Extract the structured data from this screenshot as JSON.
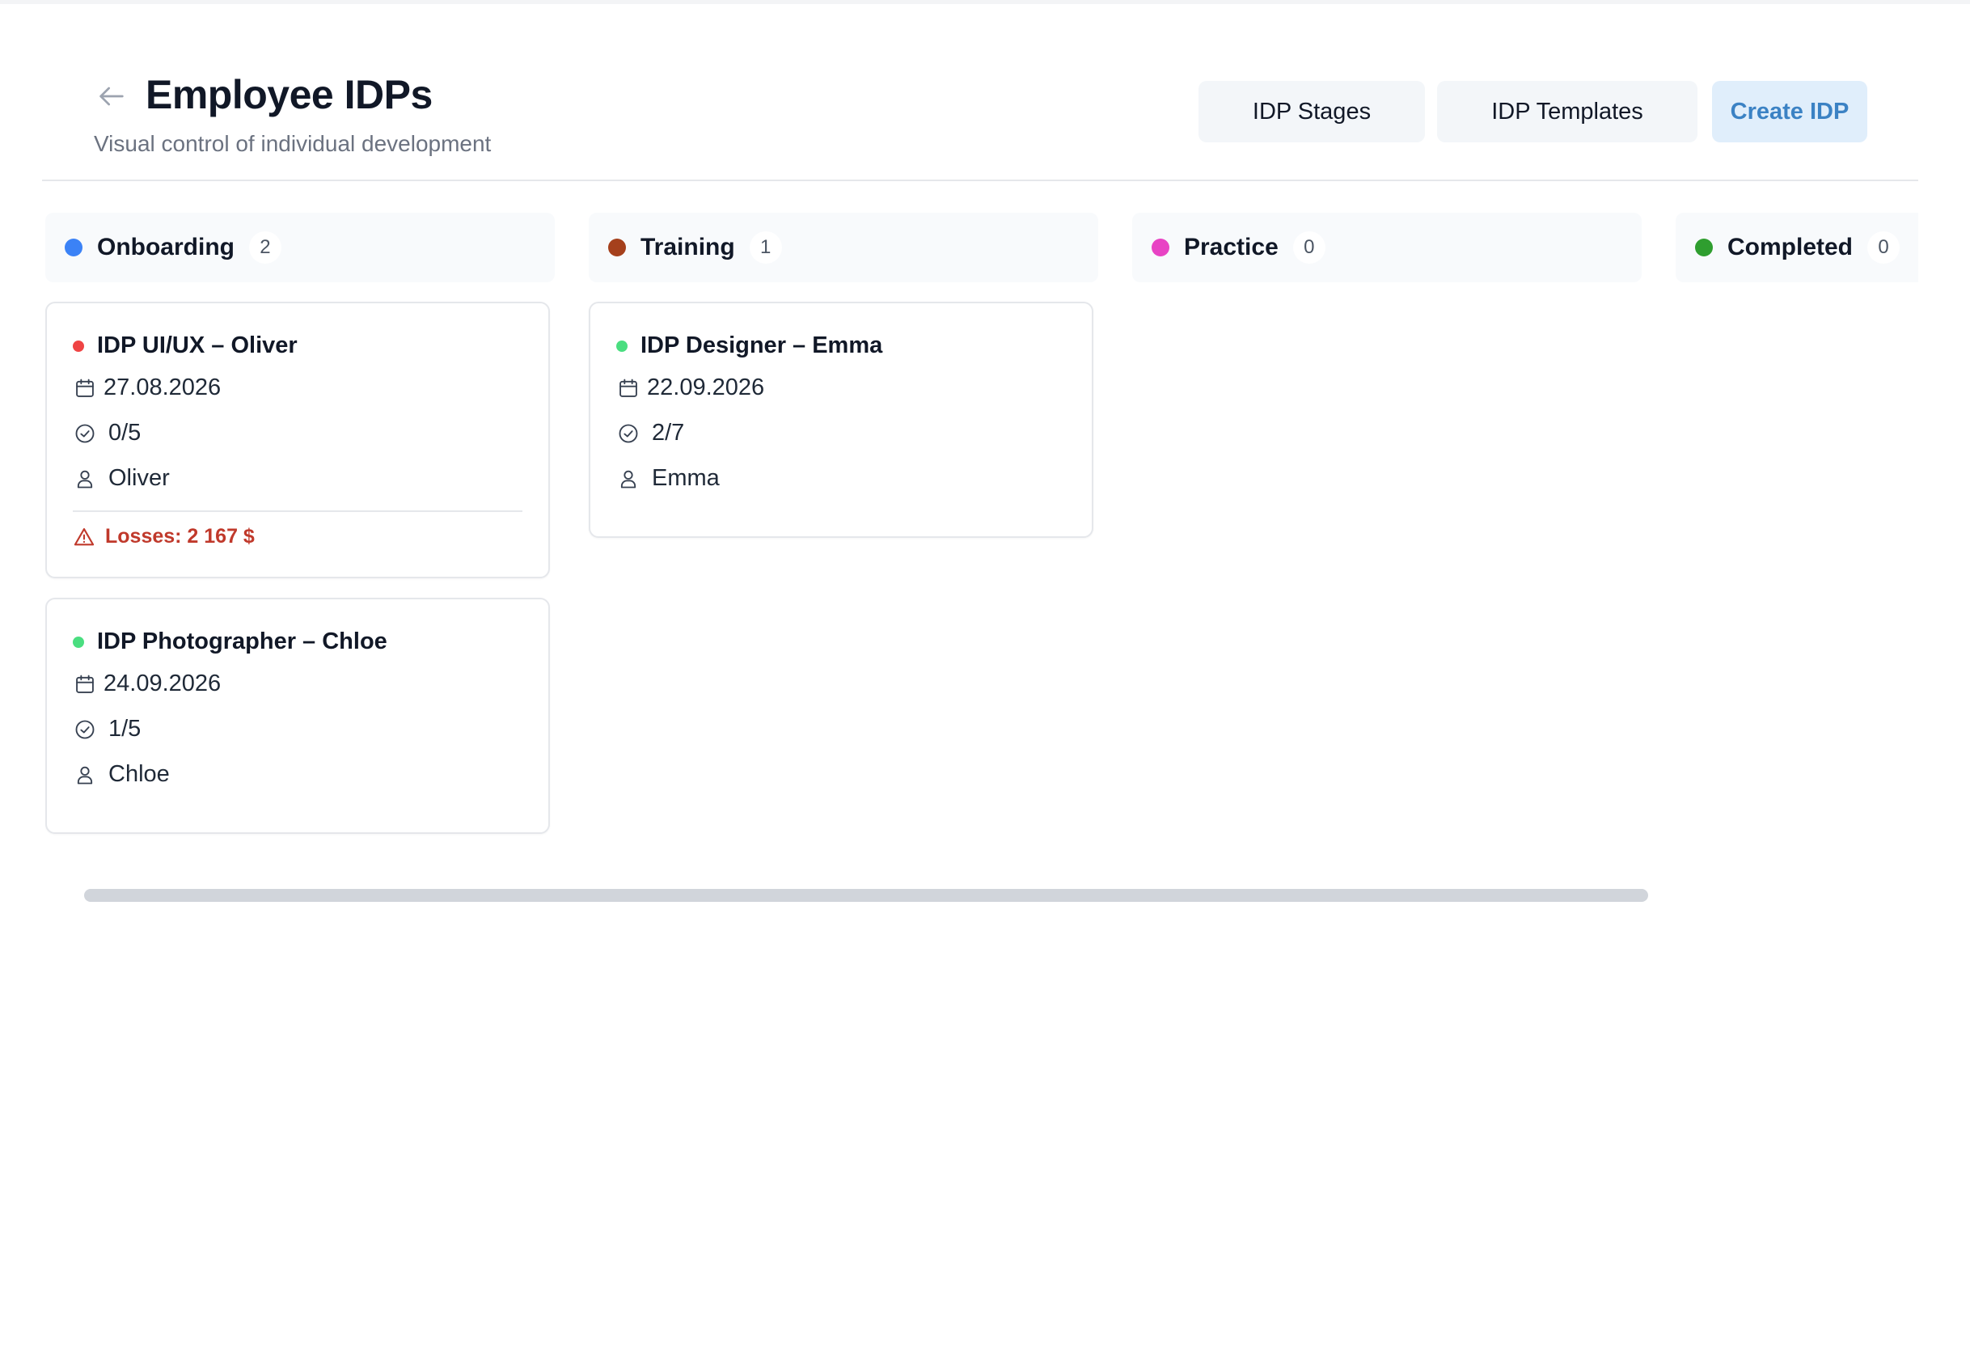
{
  "header": {
    "title": "Employee IDPs",
    "subtitle": "Visual control of individual development",
    "back_icon": "arrow-left-icon",
    "buttons": {
      "stages": "IDP Stages",
      "templates": "IDP Templates",
      "create": "Create IDP"
    },
    "accent_color": "#3b82c4"
  },
  "columns": [
    {
      "title": "Onboarding",
      "count": "2",
      "color": "#3b82f6",
      "cards": [
        {
          "title": "IDP UI/UX – Oliver",
          "priority_color": "#ef4444",
          "date": "27.08.2026",
          "tasks": "0/5",
          "assignee": "Oliver",
          "losses": "Losses: 2 167 $"
        },
        {
          "title": "IDP Photographer – Chloe",
          "priority_color": "#4ade80",
          "date": "24.09.2026",
          "tasks": "1/5",
          "assignee": "Chloe"
        }
      ]
    },
    {
      "title": "Training",
      "count": "1",
      "color": "#a5401c",
      "cards": [
        {
          "title": "IDP Designer – Emma",
          "priority_color": "#4ade80",
          "date": "22.09.2026",
          "tasks": "2/7",
          "assignee": "Emma"
        }
      ]
    },
    {
      "title": "Practice",
      "count": "0",
      "color": "#e843c4",
      "cards": []
    },
    {
      "title": "Completed",
      "count": "0",
      "color": "#2f9e2f",
      "cards": []
    }
  ],
  "icons": {
    "date": "calendar-icon",
    "tasks": "check-circle-icon",
    "assignee": "user-icon",
    "losses": "warning-triangle-icon"
  }
}
